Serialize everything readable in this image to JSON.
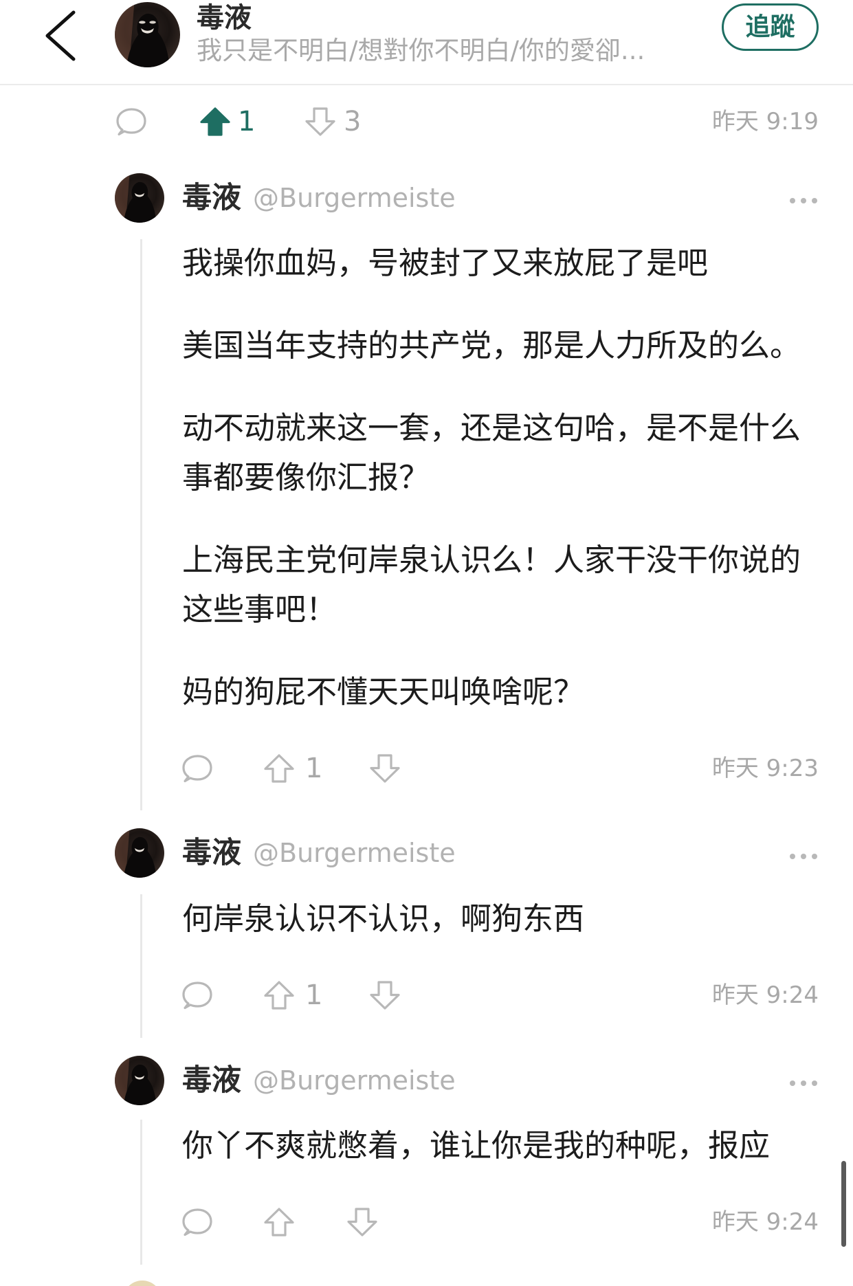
{
  "header": {
    "back_icon": "chevron-left-icon",
    "title": "毒液",
    "subtitle": "我只是不明白/想對你不明白/你的愛卻...",
    "follow_label": "追蹤"
  },
  "post_actions": {
    "upvote_count": "1",
    "downvote_count": "3",
    "upvoted": true,
    "timestamp": "昨天 9:19"
  },
  "comments": [
    {
      "author": "毒液",
      "handle": "@Burgermeiste",
      "paragraphs": [
        [
          "我操你血妈，号被封了又来放屁了是吧"
        ],
        [
          "美国当年支持的共产党，那是人力所及的么。"
        ],
        [
          "动不动就来这一套，还是这句哈，是不是什么",
          "事都要像你汇报？"
        ],
        [
          "上海民主党何岸泉认识么！人家干没干你说的",
          "这些事吧！"
        ],
        [
          "妈的狗屁不懂天天叫唤啥呢？"
        ]
      ],
      "upvote_count": "1",
      "timestamp": "昨天 9:23"
    },
    {
      "author": "毒液",
      "handle": "@Burgermeiste",
      "paragraphs": [
        [
          "何岸泉认识不认识，啊狗东西"
        ]
      ],
      "upvote_count": "1",
      "timestamp": "昨天 9:24"
    },
    {
      "author": "毒液",
      "handle": "@Burgermeiste",
      "paragraphs": [
        [
          "你丫不爽就憋着，谁让你是我的种呢，报应"
        ]
      ],
      "timestamp": "昨天 9:24"
    }
  ],
  "icons": {
    "back": "chevron-left-icon",
    "comment": "comment-bubble-icon",
    "upvote": "upvote-arrow-icon",
    "downvote": "downvote-arrow-icon",
    "more": "more-dots-icon"
  },
  "colors": {
    "accent": "#1e6e62",
    "text": "#1c1c1c",
    "muted": "#a8a8a8",
    "icon": "#b8b8b8",
    "thread_line": "#e8e8e8"
  }
}
